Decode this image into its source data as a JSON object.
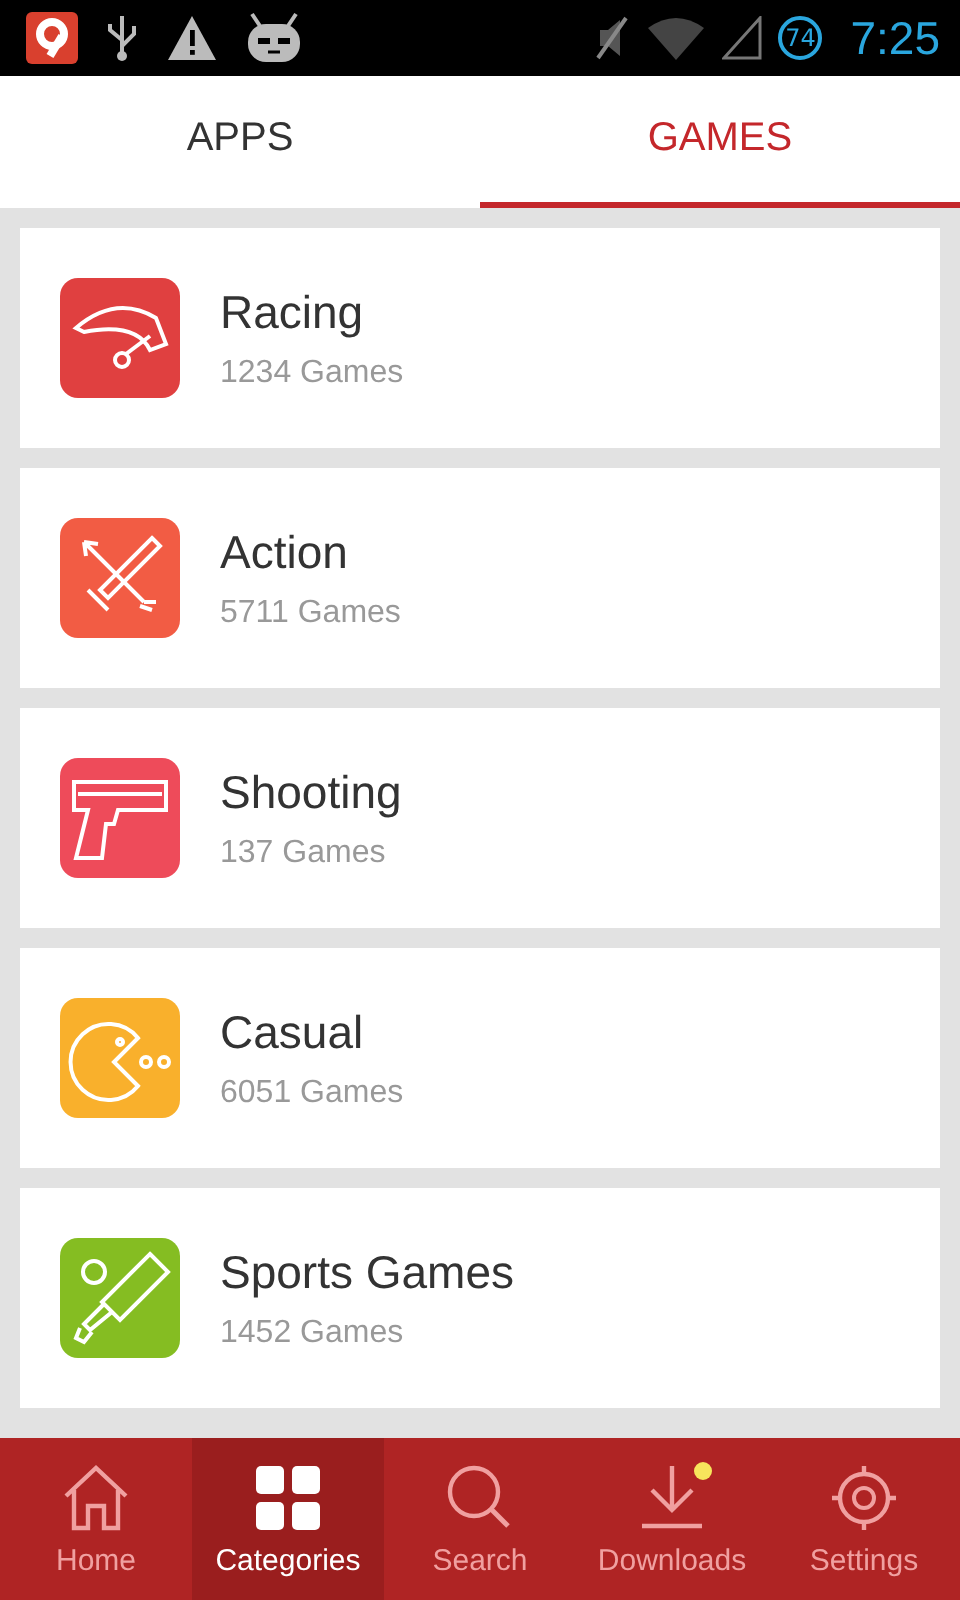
{
  "status_bar": {
    "battery": "74",
    "time": "7:25"
  },
  "tabs": [
    {
      "label": "APPS",
      "selected": false
    },
    {
      "label": "GAMES",
      "selected": true
    }
  ],
  "categories": [
    {
      "kind": "racing",
      "name": "Racing",
      "count": "1234 Games",
      "color": "#e04040"
    },
    {
      "kind": "action",
      "name": "Action",
      "count": "5711 Games",
      "color": "#f25c44"
    },
    {
      "kind": "shooting",
      "name": "Shooting",
      "count": "137 Games",
      "color": "#ee4b5a"
    },
    {
      "kind": "casual",
      "name": "Casual",
      "count": "6051 Games",
      "color": "#f9b02c"
    },
    {
      "kind": "sports",
      "name": "Sports Games",
      "count": "1452 Games",
      "color": "#85bd22"
    }
  ],
  "nav": [
    {
      "kind": "home",
      "label": "Home",
      "selected": false,
      "badge": false
    },
    {
      "kind": "categories",
      "label": "Categories",
      "selected": true,
      "badge": false
    },
    {
      "kind": "search",
      "label": "Search",
      "selected": false,
      "badge": false
    },
    {
      "kind": "downloads",
      "label": "Downloads",
      "selected": false,
      "badge": true
    },
    {
      "kind": "settings",
      "label": "Settings",
      "selected": false,
      "badge": false
    }
  ]
}
